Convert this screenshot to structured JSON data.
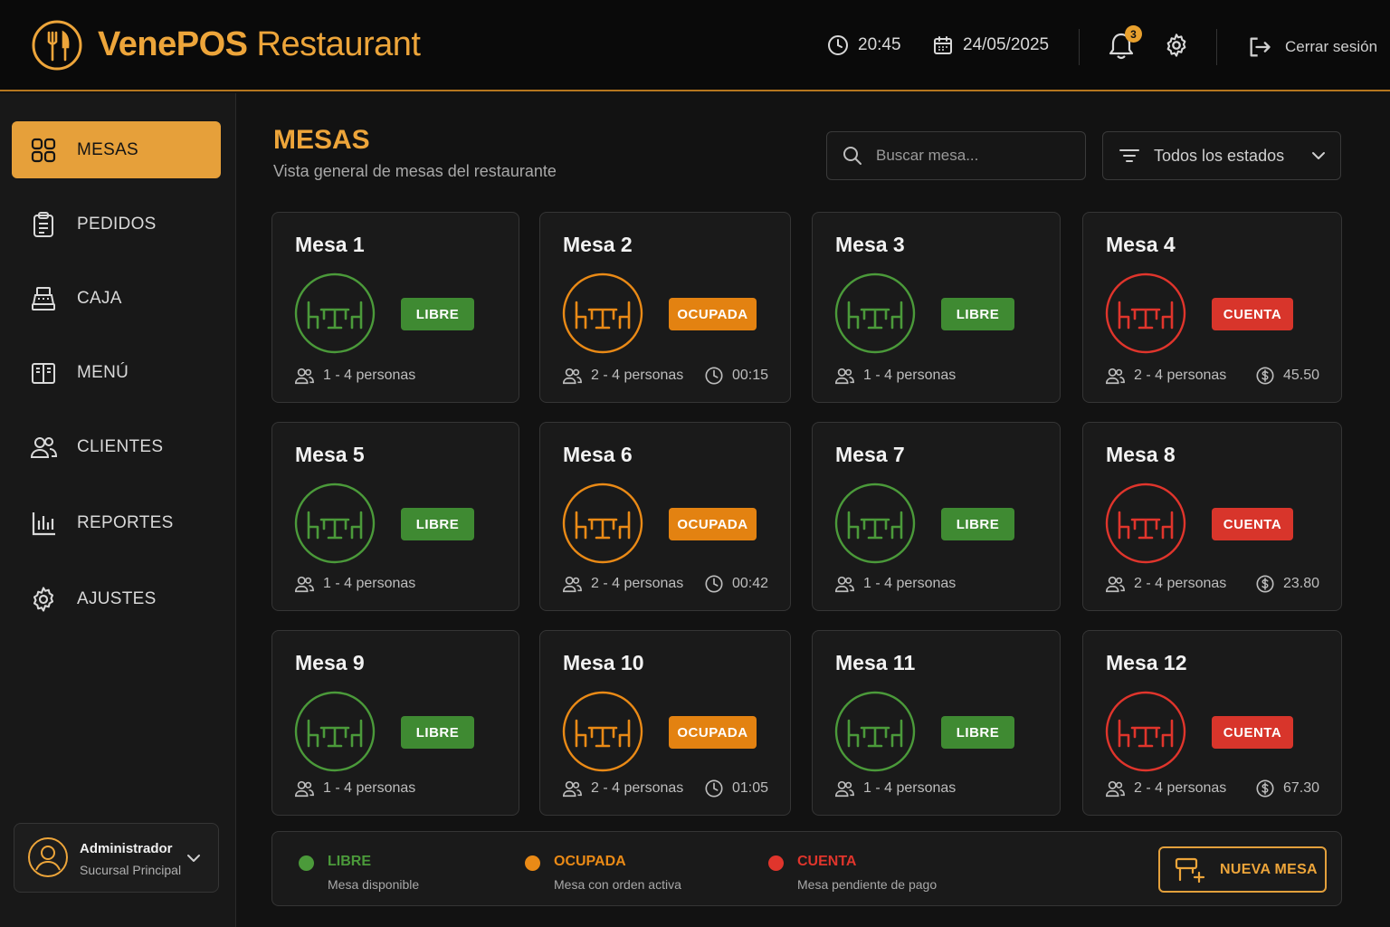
{
  "header": {
    "brand_bold": "VenePOS",
    "brand_light": "Restaurant",
    "time": "20:45",
    "date": "24/05/2025",
    "notifications_count": "3",
    "logout_label": "Cerrar sesión"
  },
  "sidebar": {
    "items": [
      {
        "label": "MESAS",
        "icon": "grid-icon",
        "active": true
      },
      {
        "label": "PEDIDOS",
        "icon": "clipboard-icon"
      },
      {
        "label": "CAJA",
        "icon": "cash-register-icon"
      },
      {
        "label": "MENÚ",
        "icon": "book-icon"
      },
      {
        "label": "CLIENTES",
        "icon": "users-icon"
      },
      {
        "label": "REPORTES",
        "icon": "bar-chart-icon"
      },
      {
        "label": "AJUSTES",
        "icon": "gear-icon"
      }
    ],
    "user": {
      "name": "Administrador",
      "branch": "Sucursal Principal"
    }
  },
  "main": {
    "title": "MESAS",
    "subtitle": "Vista general de mesas del restaurante",
    "search_placeholder": "Buscar mesa...",
    "filter_label": "Todos los estados"
  },
  "tables": [
    {
      "name": "Mesa 1",
      "status": "LIBRE",
      "capacity": "1 - 4 personas",
      "extra": ""
    },
    {
      "name": "Mesa 2",
      "status": "OCUPADA",
      "capacity": "2 - 4 personas",
      "extra": "00:15"
    },
    {
      "name": "Mesa 3",
      "status": "LIBRE",
      "capacity": "1 - 4 personas",
      "extra": ""
    },
    {
      "name": "Mesa 4",
      "status": "CUENTA",
      "capacity": "2 - 4 personas",
      "extra": "45.50"
    },
    {
      "name": "Mesa 5",
      "status": "LIBRE",
      "capacity": "1 - 4 personas",
      "extra": ""
    },
    {
      "name": "Mesa 6",
      "status": "OCUPADA",
      "capacity": "2 - 4 personas",
      "extra": "00:42"
    },
    {
      "name": "Mesa 7",
      "status": "LIBRE",
      "capacity": "1 - 4 personas",
      "extra": ""
    },
    {
      "name": "Mesa 8",
      "status": "CUENTA",
      "capacity": "2 - 4 personas",
      "extra": "23.80"
    },
    {
      "name": "Mesa 9",
      "status": "LIBRE",
      "capacity": "1 - 4 personas",
      "extra": ""
    },
    {
      "name": "Mesa 10",
      "status": "OCUPADA",
      "capacity": "2 - 4 personas",
      "extra": "01:05"
    },
    {
      "name": "Mesa 11",
      "status": "LIBRE",
      "capacity": "1 - 4 personas",
      "extra": ""
    },
    {
      "name": "Mesa 12",
      "status": "CUENTA",
      "capacity": "2 - 4 personas",
      "extra": "67.30"
    }
  ],
  "legend": [
    {
      "label": "LIBRE",
      "desc": "Mesa disponible",
      "color": "#4b9a3a"
    },
    {
      "label": "OCUPADA",
      "desc": "Mesa con orden activa",
      "color": "#ea8a16"
    },
    {
      "label": "CUENTA",
      "desc": "Mesa pendiente de pago",
      "color": "#e0352c"
    }
  ],
  "new_table_label": "NUEVA MESA",
  "colors": {
    "accent": "#eda53a",
    "libre": "#4b9a3a",
    "ocupada": "#ea8a16",
    "cuenta": "#e0352c"
  }
}
